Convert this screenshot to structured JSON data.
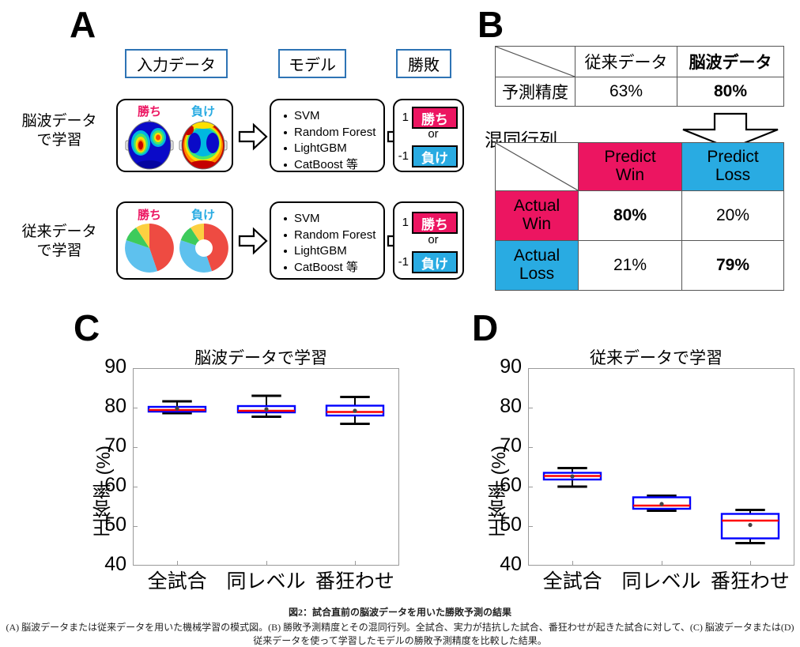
{
  "panels": {
    "a": {
      "letter": "A",
      "headers": [
        "入力データ",
        "モデル",
        "勝敗"
      ],
      "rows": [
        {
          "label": "脳波データ\nで学習",
          "label_line1": "脳波データ",
          "label_line2": "で学習",
          "data_kind": "eeg-topoplot",
          "win_label": "勝ち",
          "loss_label": "負け",
          "models": [
            "SVM",
            "Random Forest",
            "LightGBM",
            "CatBoost 等"
          ],
          "out_win_value": "1",
          "out_win_label": "勝ち",
          "out_or": "or",
          "out_loss_value": "-1",
          "out_loss_label": "負け"
        },
        {
          "label": "従来データ\nで学習",
          "label_line1": "従来データ",
          "label_line2": "で学習",
          "data_kind": "pie-donut",
          "win_label": "勝ち",
          "loss_label": "負け",
          "models": [
            "SVM",
            "Random Forest",
            "LightGBM",
            "CatBoost 等"
          ],
          "out_win_value": "1",
          "out_win_label": "勝ち",
          "out_or": "or",
          "out_loss_value": "-1",
          "out_loss_label": "負け"
        }
      ]
    },
    "b": {
      "letter": "B",
      "accuracy_table": {
        "corner": "",
        "columns": [
          "従来データ",
          "脳波データ"
        ],
        "row_label": "予測精度",
        "values": [
          "63%",
          "80%"
        ]
      },
      "confusion_label": "混同行列",
      "confusion_matrix": {
        "corner": "",
        "col_headers": [
          {
            "line1": "Predict",
            "line2": "Win"
          },
          {
            "line1": "Predict",
            "line2": "Loss"
          }
        ],
        "row_headers": [
          {
            "line1": "Actual",
            "line2": "Win"
          },
          {
            "line1": "Actual",
            "line2": "Loss"
          }
        ],
        "cells": [
          [
            "80%",
            "20%"
          ],
          [
            "21%",
            "79%"
          ]
        ]
      }
    },
    "c": {
      "letter": "C"
    },
    "d": {
      "letter": "D"
    }
  },
  "colors": {
    "win_pink": "#ec1561",
    "loss_cyan": "#29abe2",
    "header_blue": "#2e74b5",
    "box_edge": "#0000ff",
    "median_red": "#ff0000",
    "whisker": "#000000"
  },
  "chart_data": [
    {
      "type": "box",
      "panel": "C",
      "title": "脳波データで学習",
      "xlabel": "",
      "ylabel": "正答率 (%)",
      "ylim": [
        40,
        90
      ],
      "yticks": [
        40,
        50,
        60,
        70,
        80,
        90
      ],
      "categories": [
        "全試合",
        "同レベル",
        "番狂わせ"
      ],
      "grid": false,
      "boxes": [
        {
          "category": "全試合",
          "whisker_low": 78.6,
          "q1": 79.0,
          "median": 79.4,
          "q3": 80.2,
          "whisker_high": 81.6,
          "mean": 79.8
        },
        {
          "category": "同レベル",
          "whisker_low": 77.7,
          "q1": 78.8,
          "median": 79.2,
          "q3": 80.4,
          "whisker_high": 83.0,
          "mean": 79.6
        },
        {
          "category": "番狂わせ",
          "whisker_low": 75.9,
          "q1": 78.0,
          "median": 78.9,
          "q3": 80.5,
          "whisker_high": 82.7,
          "mean": 79.2
        }
      ]
    },
    {
      "type": "box",
      "panel": "D",
      "title": "従来データで学習",
      "xlabel": "",
      "ylabel": "正答率 (%)",
      "ylim": [
        40,
        90
      ],
      "yticks": [
        40,
        50,
        60,
        70,
        80,
        90
      ],
      "categories": [
        "全試合",
        "同レベル",
        "番狂わせ"
      ],
      "grid": false,
      "boxes": [
        {
          "category": "全試合",
          "whisker_low": 60.0,
          "q1": 61.8,
          "median": 62.7,
          "q3": 63.5,
          "whisker_high": 64.7,
          "mean": 62.6
        },
        {
          "category": "同レベル",
          "whisker_low": 53.9,
          "q1": 54.4,
          "median": 55.2,
          "q3": 57.3,
          "whisker_high": 57.7,
          "mean": 55.6
        },
        {
          "category": "番狂わせ",
          "whisker_low": 45.7,
          "q1": 46.9,
          "median": 51.4,
          "q3": 53.1,
          "whisker_high": 54.1,
          "mean": 50.3
        }
      ]
    }
  ],
  "caption": {
    "title": "図2：試合直前の脳波データを用いた勝敗予測の結果",
    "line1": "(A) 脳波データまたは従来データを用いた機械学習の模式図。(B) 勝敗予測精度とその混同行列。全試合、実力が拮抗した試合、番狂わせが起きた試合に対して、(C) 脳波データまたは(D)",
    "line2": "従来データを使って学習したモデルの勝敗予測精度を比較した結果。"
  }
}
